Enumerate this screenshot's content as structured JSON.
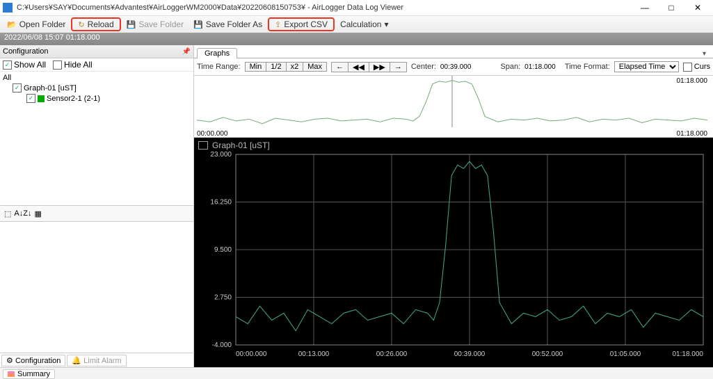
{
  "window": {
    "title": "C:¥Users¥SAY¥Documents¥Advantest¥AirLoggerWM2000¥Data¥20220608150753¥ - AirLogger Data Log Viewer",
    "min": "—",
    "max": "□",
    "close": "✕"
  },
  "toolbar": {
    "open": "Open Folder",
    "reload": "Reload",
    "save": "Save Folder",
    "saveas": "Save Folder As",
    "export": "Export CSV",
    "calc": "Calculation"
  },
  "datebar": "2022/06/08 15:07  01:18.000",
  "config": {
    "title": "Configuration",
    "showall": "Show All",
    "hideall": "Hide All",
    "root": "All",
    "graph": "Graph-01  [uST]",
    "sensor": "Sensor2-1 (2-1)"
  },
  "lefttools": {
    "sort": "A↓Z↓"
  },
  "leftbottom": {
    "cfg": "Configuration",
    "limit": "Limit Alarm"
  },
  "righttab": "Graphs",
  "ctrl": {
    "label_range": "Time Range:",
    "min": "Min",
    "half": "1/2",
    "x2": "x2",
    "max": "Max",
    "arrow_left": "←",
    "step_left": "◀◀",
    "step_right": "▶▶",
    "arrow_right": "→",
    "label_center": "Center:",
    "center_val": "00:39.000",
    "label_span": "Span:",
    "span_val": "01:18.000",
    "label_fmt": "Time Format:",
    "fmt_val": "Elapsed Time",
    "curs": "Curs"
  },
  "overview": {
    "left": "00:00.000",
    "right": "01:18.000"
  },
  "main": {
    "right": "01:18.000"
  },
  "graph_title": "Graph-01 [uST]",
  "bottom": {
    "summary": "Summary"
  },
  "chart_data": {
    "type": "line",
    "title": "Graph-01 [uST]",
    "xlabel": "Elapsed Time",
    "ylabel": "uST",
    "x_ticks": [
      "00:00.000",
      "00:13.000",
      "00:26.000",
      "00:39.000",
      "00:52.000",
      "01:05.000",
      "01:18.000"
    ],
    "y_ticks": [
      -4.0,
      2.75,
      9.5,
      16.25,
      23.0
    ],
    "ylim": [
      -4.0,
      23.0
    ],
    "xlim_seconds": [
      0,
      78
    ],
    "series": [
      {
        "name": "Sensor2-1 (2-1)",
        "color": "#4a8",
        "x_seconds": [
          0,
          2,
          4,
          6,
          8,
          10,
          12,
          14,
          16,
          18,
          20,
          22,
          24,
          26,
          28,
          30,
          32,
          33,
          34,
          35,
          36,
          37,
          38,
          39,
          40,
          41,
          42,
          43,
          44,
          46,
          48,
          50,
          52,
          54,
          56,
          58,
          60,
          62,
          64,
          66,
          68,
          70,
          72,
          74,
          76,
          78
        ],
        "values": [
          0.0,
          -1.0,
          1.5,
          -0.5,
          0.5,
          -2.0,
          1.0,
          0.0,
          -1.0,
          0.5,
          1.0,
          -0.5,
          0.0,
          0.5,
          -1.0,
          1.0,
          0.5,
          -0.5,
          2.0,
          10.0,
          20.0,
          21.5,
          21.0,
          22.0,
          21.0,
          21.5,
          20.0,
          12.0,
          2.0,
          -1.0,
          0.5,
          0.0,
          1.0,
          -0.5,
          0.0,
          1.5,
          -1.0,
          0.5,
          0.0,
          1.0,
          -1.5,
          0.5,
          0.0,
          -0.5,
          1.0,
          0.0
        ]
      }
    ]
  }
}
